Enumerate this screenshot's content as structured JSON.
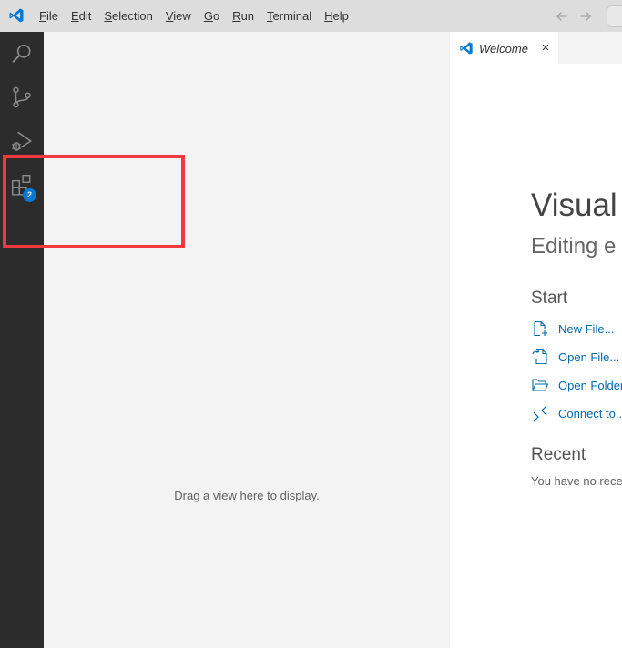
{
  "titlebar": {
    "menu": [
      {
        "label": "File",
        "mnemonic": "F"
      },
      {
        "label": "Edit",
        "mnemonic": "E"
      },
      {
        "label": "Selection",
        "mnemonic": "S"
      },
      {
        "label": "View",
        "mnemonic": "V"
      },
      {
        "label": "Go",
        "mnemonic": "G"
      },
      {
        "label": "Run",
        "mnemonic": "R"
      },
      {
        "label": "Terminal",
        "mnemonic": "T"
      },
      {
        "label": "Help",
        "mnemonic": "H"
      }
    ]
  },
  "activitybar": {
    "items": [
      {
        "name": "search",
        "icon": "search-icon"
      },
      {
        "name": "source-control",
        "icon": "source-control-icon"
      },
      {
        "name": "run-debug",
        "icon": "run-debug-icon"
      },
      {
        "name": "extensions",
        "icon": "extensions-icon",
        "badge": "2"
      }
    ]
  },
  "sidebar": {
    "empty_hint": "Drag a view here to display."
  },
  "editor": {
    "tab": {
      "label": "Welcome",
      "close": "×"
    },
    "welcome": {
      "title": "Visual",
      "subtitle": "Editing e",
      "start_heading": "Start",
      "start_links": [
        {
          "label": "New File...",
          "icon": "new-file-icon"
        },
        {
          "label": "Open File...",
          "icon": "open-file-icon"
        },
        {
          "label": "Open Folder",
          "icon": "open-folder-icon"
        },
        {
          "label": "Connect to...",
          "icon": "remote-connect-icon"
        }
      ],
      "recent_heading": "Recent",
      "recent_text": "You have no recen"
    }
  },
  "colors": {
    "accent": "#0078d4",
    "link": "#006ab1",
    "highlight": "#f0393f",
    "activitybar_bg": "#2c2c2c",
    "titlebar_bg": "#dddddd"
  }
}
